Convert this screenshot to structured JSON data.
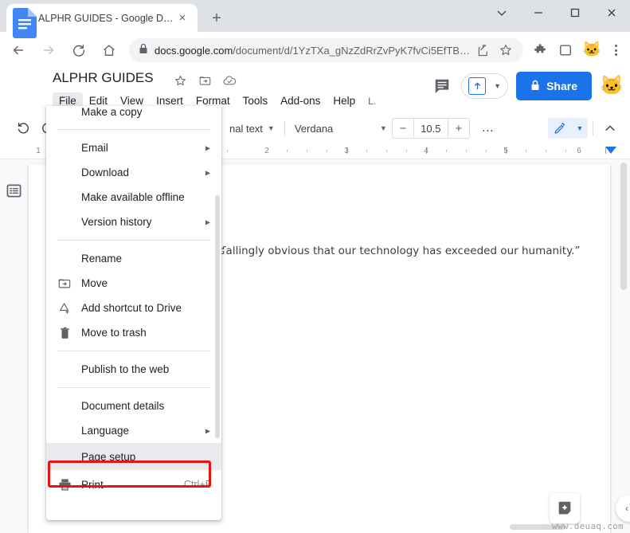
{
  "browser": {
    "tab": {
      "title": "ALPHR GUIDES - Google Docs",
      "favicon": "google-docs-favicon",
      "close_label": "×"
    },
    "new_tab_label": "+",
    "window_controls": [
      {
        "name": "tab-search",
        "label": "∨"
      },
      {
        "name": "minimize",
        "label": "—"
      },
      {
        "name": "maximize",
        "label": "□"
      },
      {
        "name": "close",
        "label": "×"
      }
    ],
    "nav": {
      "back": "←",
      "forward": "→",
      "reload": "↻",
      "home": "⌂"
    },
    "omnibox": {
      "lock_icon": "lock-icon",
      "url_domain": "docs.google.com",
      "url_path": "/document/d/1YzTXa_gNzZdRrZvPyK7fvCi5EfTB…",
      "share_icon": "share-link-icon",
      "bookmark_icon": "star-icon"
    },
    "extensions": [
      {
        "name": "extensions-puzzle-icon",
        "glyph": "🧩"
      },
      {
        "name": "side-panel-icon",
        "glyph": "□"
      }
    ],
    "profile_avatar": "🐱",
    "more_menu": "chrome-three-dot-menu"
  },
  "docs": {
    "logo": "google-docs-logo",
    "title": "ALPHR GUIDES",
    "title_icons": [
      {
        "name": "star-icon",
        "glyph": "☆"
      },
      {
        "name": "move-to-folder-icon",
        "glyph": "❐"
      },
      {
        "name": "cloud-saved-icon",
        "glyph": "☁"
      }
    ],
    "menubar": [
      {
        "label": "File",
        "active": true
      },
      {
        "label": "Edit",
        "active": false
      },
      {
        "label": "View",
        "active": false
      },
      {
        "label": "Insert",
        "active": false
      },
      {
        "label": "Format",
        "active": false
      },
      {
        "label": "Tools",
        "active": false
      },
      {
        "label": "Add-ons",
        "active": false
      },
      {
        "label": "Help",
        "active": false
      }
    ],
    "last_edit": "L.",
    "header_actions": {
      "comment_icon": "comment-history-icon",
      "present_icon": "present-icon",
      "share_label": "Share",
      "share_lock_icon": "lock-icon",
      "account_avatar": "🐱"
    },
    "toolbar": {
      "undo": "↶",
      "redo": "↷",
      "style_label": "nal text",
      "font_label": "Verdana",
      "font_size_decrease": "−",
      "font_size": "10.5",
      "font_size_increase": "+",
      "more_label": "…",
      "pen_icon": "pen-edit-icon",
      "collapse_icon": "⌃"
    },
    "ruler": {
      "marks": [
        "1",
        "2",
        "3",
        "4",
        "5",
        "6"
      ]
    },
    "outline_icon": "document-outline-icon",
    "document_text": "ʛallingly obvious that our technology has exceeded our humanity.”",
    "explore_icon": "explore-icon",
    "side_toggle_icon": "‹",
    "watermark": "www.deuaq.com"
  },
  "file_menu": {
    "highlight_color": "#e8140f",
    "items": [
      {
        "label": "Make a copy",
        "icon": "",
        "arrow": false,
        "accel": "",
        "highlighted": false,
        "partial": true
      },
      {
        "type": "separator"
      },
      {
        "label": "Email",
        "icon": "",
        "arrow": true,
        "accel": "",
        "highlighted": false
      },
      {
        "label": "Download",
        "icon": "",
        "arrow": true,
        "accel": "",
        "highlighted": false
      },
      {
        "label": "Make available offline",
        "icon": "",
        "arrow": false,
        "accel": "",
        "highlighted": false
      },
      {
        "label": "Version history",
        "icon": "",
        "arrow": true,
        "accel": "",
        "highlighted": false
      },
      {
        "type": "separator"
      },
      {
        "label": "Rename",
        "icon": "",
        "arrow": false,
        "accel": "",
        "highlighted": false
      },
      {
        "label": "Move",
        "icon": "move-folder-icon",
        "arrow": false,
        "accel": "",
        "highlighted": false
      },
      {
        "label": "Add shortcut to Drive",
        "icon": "add-shortcut-icon",
        "arrow": false,
        "accel": "",
        "highlighted": false
      },
      {
        "label": "Move to trash",
        "icon": "trash-icon",
        "arrow": false,
        "accel": "",
        "highlighted": false
      },
      {
        "type": "separator"
      },
      {
        "label": "Publish to the web",
        "icon": "",
        "arrow": false,
        "accel": "",
        "highlighted": false
      },
      {
        "type": "separator"
      },
      {
        "label": "Document details",
        "icon": "",
        "arrow": false,
        "accel": "",
        "highlighted": false
      },
      {
        "label": "Language",
        "icon": "",
        "arrow": true,
        "accel": "",
        "highlighted": false
      },
      {
        "label": "Page setup",
        "icon": "",
        "arrow": false,
        "accel": "",
        "highlighted": true
      },
      {
        "label": "Print",
        "icon": "printer-icon",
        "arrow": false,
        "accel": "Ctrl+P",
        "highlighted": false
      }
    ]
  }
}
